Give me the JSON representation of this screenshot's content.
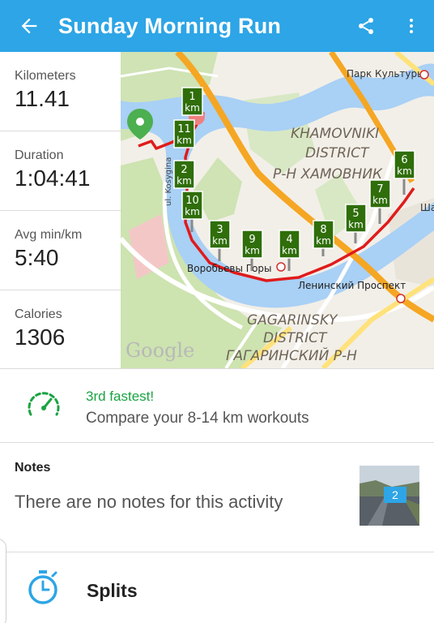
{
  "appbar": {
    "title": "Sunday Morning Run",
    "back_icon": "arrow-left-icon",
    "share_icon": "share-icon",
    "menu_icon": "more-vertical-icon",
    "color": "#2da5e6"
  },
  "stats": [
    {
      "label": "Kilometers",
      "value": "11.41"
    },
    {
      "label": "Duration",
      "value": "1:04:41"
    },
    {
      "label": "Avg min/km",
      "value": "5:40"
    },
    {
      "label": "Calories",
      "value": "1306"
    }
  ],
  "map": {
    "place_labels": {
      "park": "Парк Культуры",
      "khamovniki_1": "KHAMOVNIKI",
      "khamovniki_2": "DISTRICT",
      "khamovniki_3": "Р-Н ХАМОВНИК",
      "street_kosygina": "ul. Kosygina",
      "vorobyevy": "Воробьевы Горы",
      "leninsky": "Ленинский Проспект",
      "gagarinsky_1": "GAGARINSKY",
      "gagarinsky_2": "DISTRICT",
      "gagarinsky_3": "ГАГАРИНСКИЙ Р-Н",
      "cut_label": "Ша",
      "google": "Google"
    },
    "km_unit": "km",
    "km_markers": [
      "1",
      "11",
      "2",
      "10",
      "3",
      "9",
      "4",
      "8",
      "5",
      "7",
      "6"
    ],
    "route_color": "#e01b1b",
    "marker_color": "#2f6e0a",
    "start_pin_color": "#4caf50"
  },
  "fastest": {
    "rank_text": "3rd fastest!",
    "compare_text": "Compare your 8-14 km workouts",
    "icon": "speedometer-icon",
    "color": "#1aa342"
  },
  "notes": {
    "heading": "Notes",
    "empty_text": "There are no notes for this activity",
    "photo_count": "2"
  },
  "splits": {
    "label": "Splits",
    "icon": "stopwatch-icon"
  }
}
